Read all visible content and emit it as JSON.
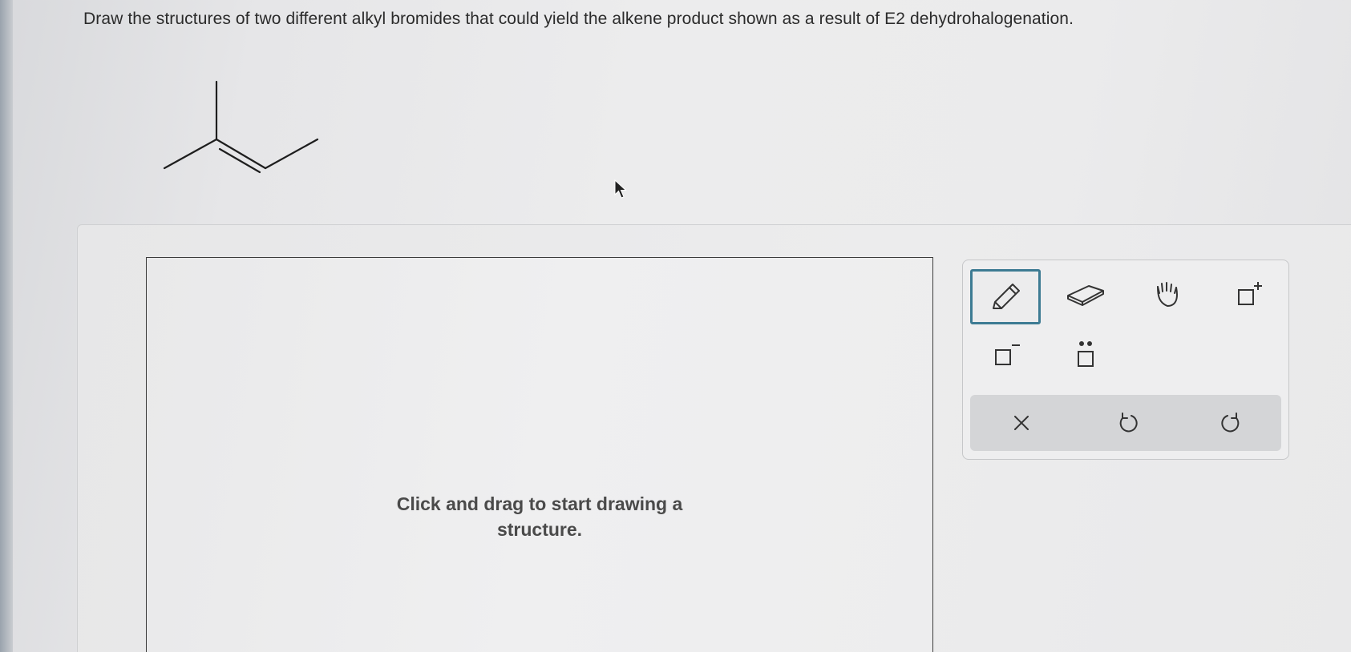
{
  "question": {
    "text": "Draw the structures of two different alkyl bromides that could yield the alkene product shown as a result of E2 dehydrohalogenation."
  },
  "canvas": {
    "hint_line1": "Click and drag to start drawing a",
    "hint_line2": "structure."
  },
  "toolbox": {
    "tools": [
      {
        "name": "pencil-icon",
        "active": true
      },
      {
        "name": "eraser-icon",
        "active": false
      },
      {
        "name": "hand-icon",
        "active": false
      },
      {
        "name": "positive-charge-icon",
        "active": false
      },
      {
        "name": "negative-charge-icon",
        "active": false
      },
      {
        "name": "lone-pair-icon",
        "active": false
      }
    ],
    "actions": [
      "clear-icon",
      "undo-icon",
      "redo-icon"
    ],
    "accent_color": "#3d7b93"
  }
}
